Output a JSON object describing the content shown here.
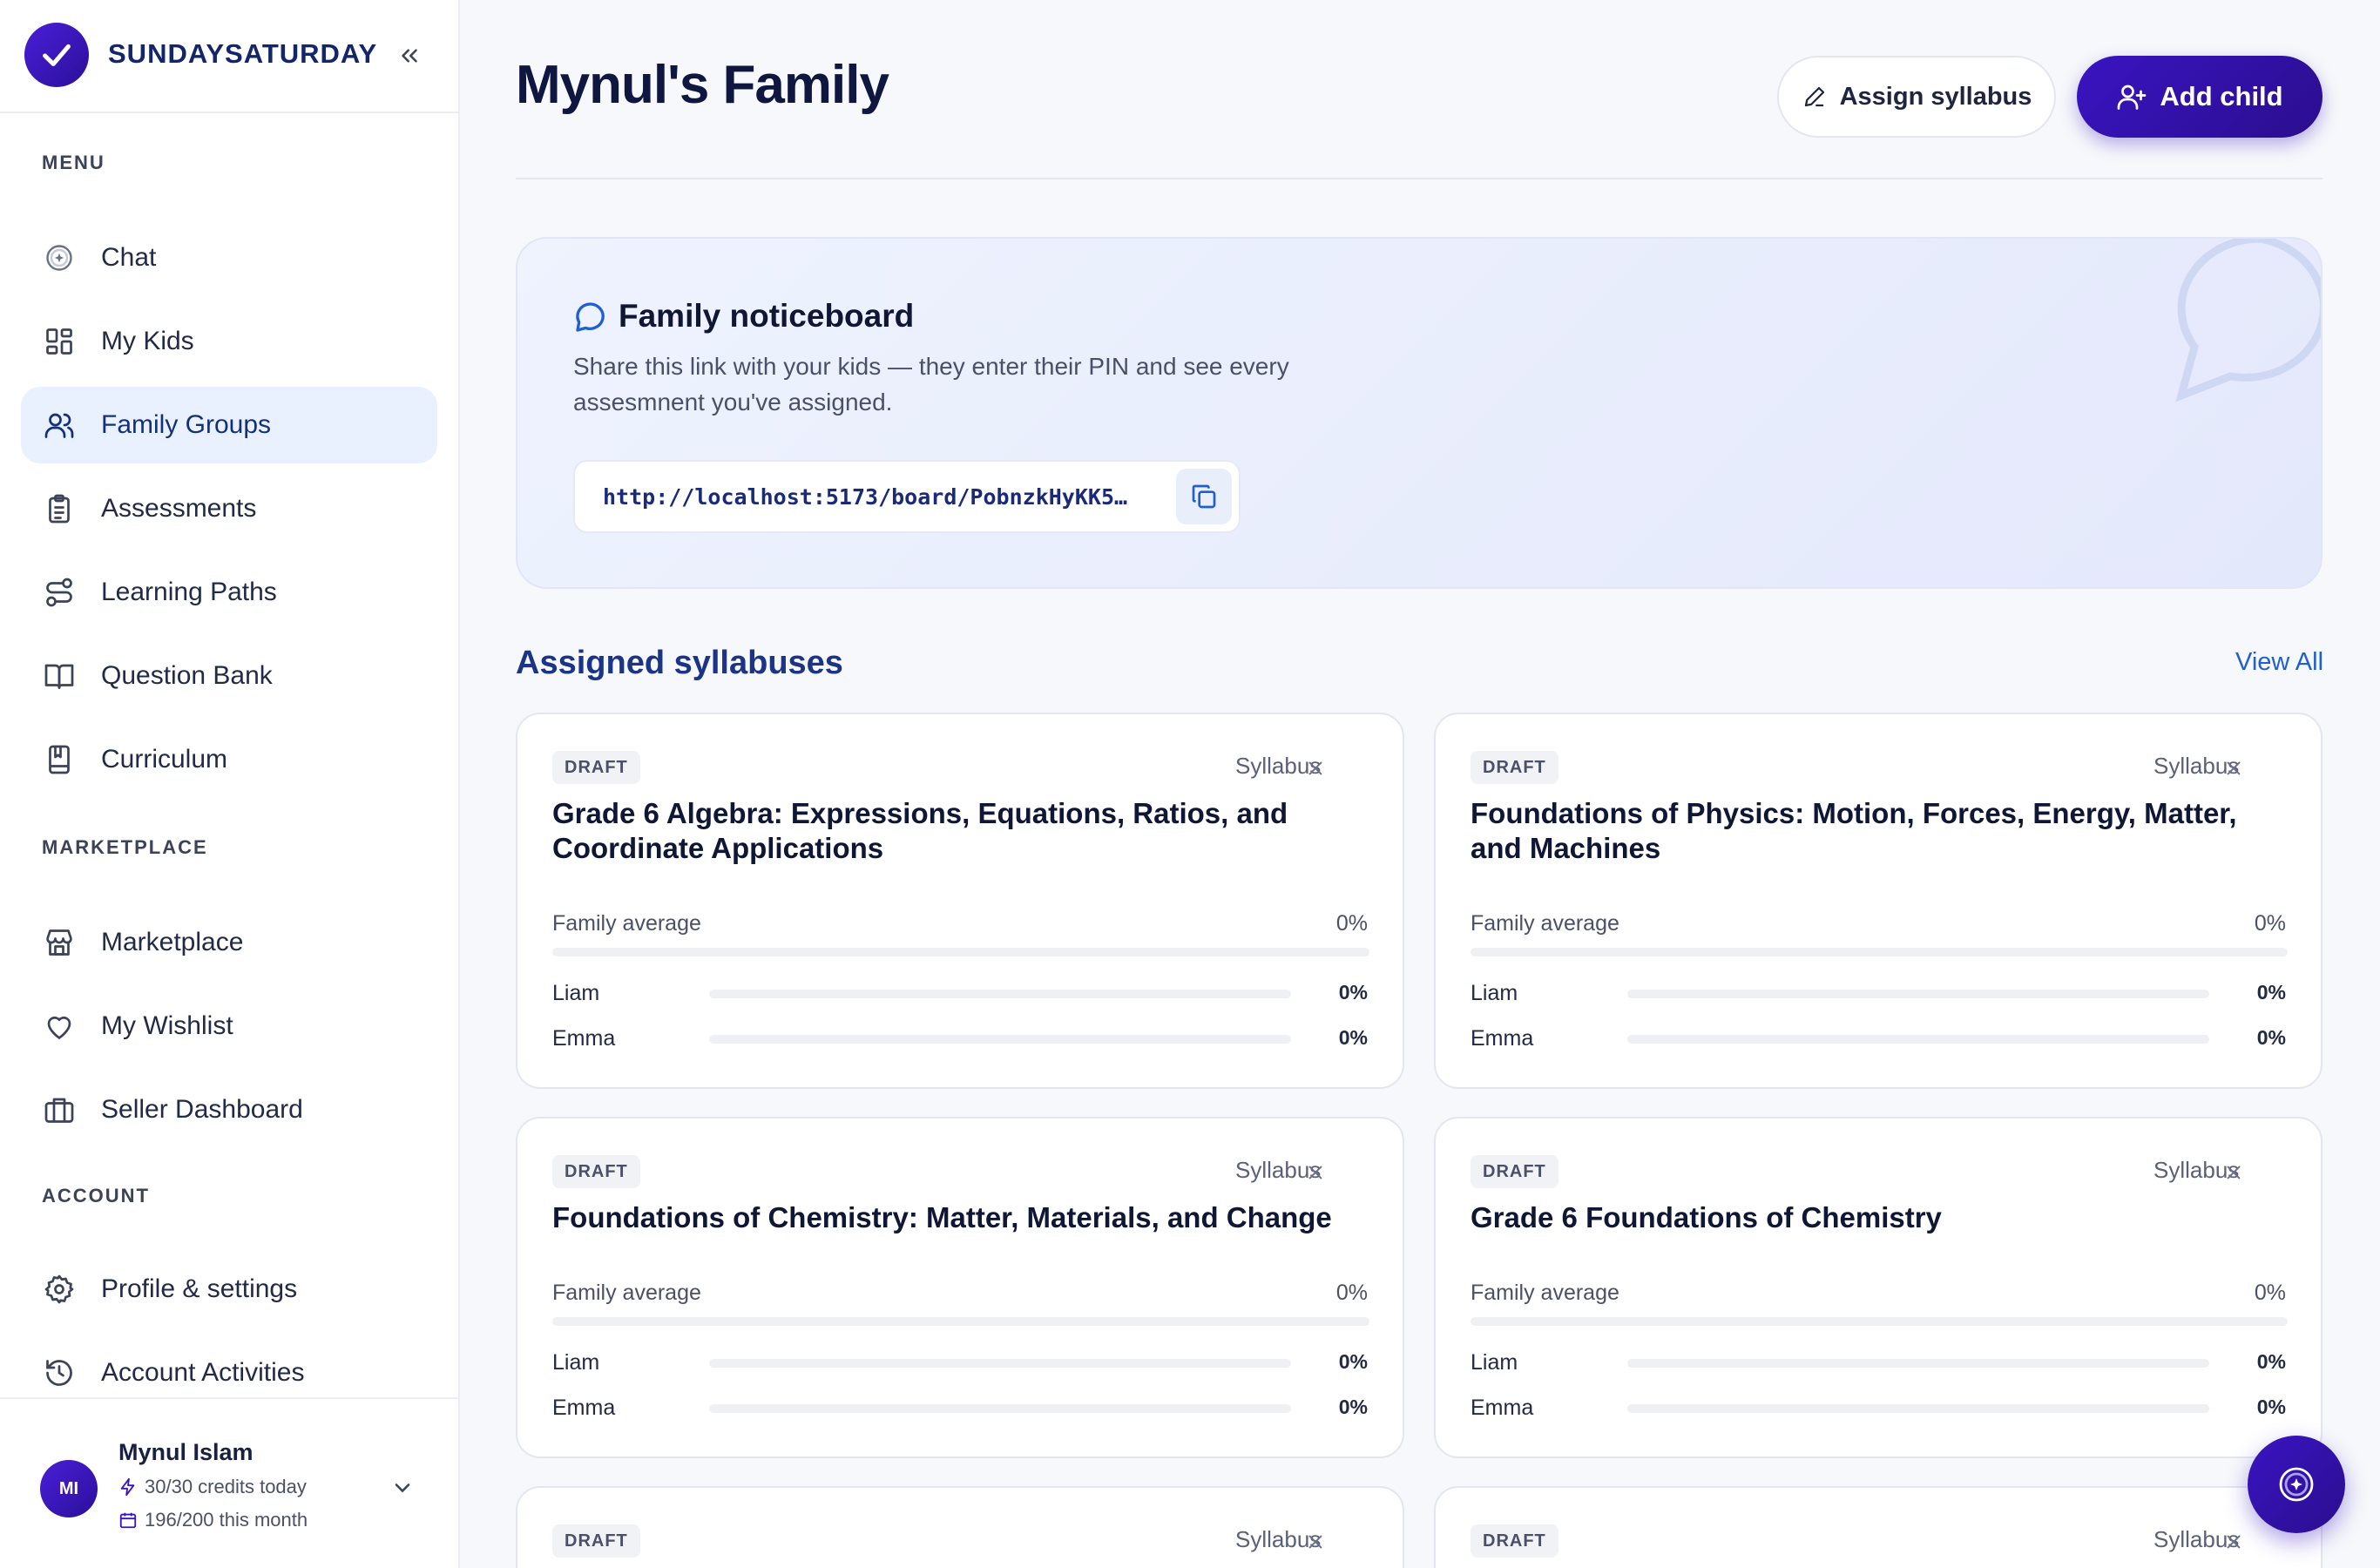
{
  "brand": {
    "name": "SUNDAYSATURDAY",
    "logo_icon": "check-icon"
  },
  "sidebar": {
    "sections": {
      "menu": "MENU",
      "marketplace": "MARKETPLACE",
      "account": "ACCOUNT"
    },
    "menu_items": [
      {
        "label": "Chat",
        "icon": "sparkle-circle-icon"
      },
      {
        "label": "My Kids",
        "icon": "grid-icon"
      },
      {
        "label": "Family Groups",
        "icon": "users-icon",
        "active": true
      },
      {
        "label": "Assessments",
        "icon": "clipboard-icon"
      },
      {
        "label": "Learning Paths",
        "icon": "route-icon"
      },
      {
        "label": "Question Bank",
        "icon": "book-open-icon"
      },
      {
        "label": "Curriculum",
        "icon": "notebook-icon"
      }
    ],
    "marketplace_items": [
      {
        "label": "Marketplace",
        "icon": "store-icon"
      },
      {
        "label": "My Wishlist",
        "icon": "heart-icon"
      },
      {
        "label": "Seller Dashboard",
        "icon": "briefcase-icon"
      }
    ],
    "account_items": [
      {
        "label": "Profile & settings",
        "icon": "gear-icon"
      },
      {
        "label": "Account Activities",
        "icon": "history-icon"
      }
    ],
    "user": {
      "initials": "MI",
      "name": "Mynul Islam",
      "credits": "30/30 credits today",
      "month": "196/200 this month"
    }
  },
  "header": {
    "title": "Mynul's Family",
    "assign_label": "Assign syllabus",
    "add_child_label": "Add child"
  },
  "noticeboard": {
    "title": "Family noticeboard",
    "description": "Share this link with your kids — they enter their PIN and see every assesmnent you've assigned.",
    "link": "http://localhost:5173/board/PobnzkHyKK5…"
  },
  "syllabuses": {
    "heading": "Assigned syllabuses",
    "view_all": "View All",
    "family_average_label": "Family average",
    "cards": [
      {
        "status": "DRAFT",
        "type": "Syllabus",
        "title": "Grade 6 Algebra: Expressions, Equations, Ratios, and Coordinate Applications",
        "family_average": "0%",
        "kids": [
          {
            "name": "Liam",
            "progress": "0%"
          },
          {
            "name": "Emma",
            "progress": "0%"
          }
        ]
      },
      {
        "status": "DRAFT",
        "type": "Syllabus",
        "title": "Foundations of Physics: Motion, Forces, Energy, Matter, and Machines",
        "family_average": "0%",
        "kids": [
          {
            "name": "Liam",
            "progress": "0%"
          },
          {
            "name": "Emma",
            "progress": "0%"
          }
        ]
      },
      {
        "status": "DRAFT",
        "type": "Syllabus",
        "title": "Foundations of Chemistry: Matter, Materials, and Change",
        "family_average": "0%",
        "kids": [
          {
            "name": "Liam",
            "progress": "0%"
          },
          {
            "name": "Emma",
            "progress": "0%"
          }
        ]
      },
      {
        "status": "DRAFT",
        "type": "Syllabus",
        "title": "Grade 6 Foundations of Chemistry",
        "family_average": "0%",
        "kids": [
          {
            "name": "Liam",
            "progress": "0%"
          },
          {
            "name": "Emma",
            "progress": "0%"
          }
        ]
      },
      {
        "status": "DRAFT",
        "type": "Syllabus"
      },
      {
        "status": "DRAFT",
        "type": "Syllabus"
      }
    ]
  },
  "colors": {
    "accent": "#3a14c2",
    "active_nav_bg": "#eaf1fe",
    "link_blue": "#1f5fd1"
  }
}
